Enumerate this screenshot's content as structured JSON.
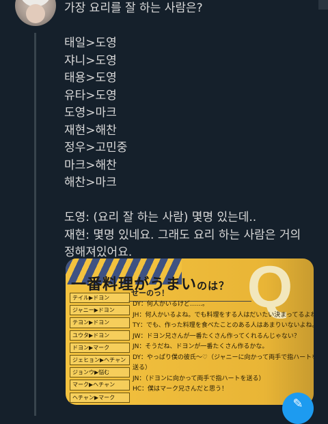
{
  "tweet": {
    "question": "가장 요리를 잘 하는 사람은?",
    "rankings": [
      "태일>도영",
      "쟈니>도영",
      "태용>도영",
      "유타>도영",
      "도영>마크",
      "재현>해찬",
      "정우>고민중",
      "마크>해찬",
      "해찬>마크"
    ],
    "dialogue": [
      "도영: (요리 잘 하는 사람) 몇명 있는데..",
      "재현: 몇명 있네요. 그래도 요리 하는 사람은 거의",
      "정해져있어요."
    ]
  },
  "media": {
    "title": "一番料理がうまい",
    "title_suffix": "のは？",
    "badge": "Q",
    "bubble": "せーのっ！",
    "names": [
      "テイル▶ドヨン",
      "ジャニー▶ドヨン",
      "テヨン▶ドヨン",
      "ユウタ▶ドヨン",
      "ドヨン▶マーク",
      "ジェヒョン▶ヘチャン",
      "ジョンウ▶悩む",
      "マーク▶ヘチャン",
      "ヘチャン▶マーク"
    ],
    "lines": [
      "DY：何人かいるけど……。",
      "JH：何人かいるよね。でも料理をする人はだいたい決まってるよね。",
      "TY：でも、作った料理を食べたことのある人はあまりいないよね。",
      "JW：ドヨン兄さんが一番たくさん作ってくれるんじゃない？",
      "JN：そうだね、ドヨンが一番たくさん作るかな。",
      "DY：やっぱり僕の彼氏〜♡（ジャニーに向かって両手で指ハートを",
      "送る）",
      "JN：（ドヨンに向かって両手で指ハートを送る）",
      "HC：僕はマーク兄さんだと思う！"
    ]
  },
  "colors": {
    "background": "#15202b",
    "text": "#d9d9d9",
    "accent": "#1d9bf0"
  },
  "icons": {
    "fab": "compose-icon"
  }
}
